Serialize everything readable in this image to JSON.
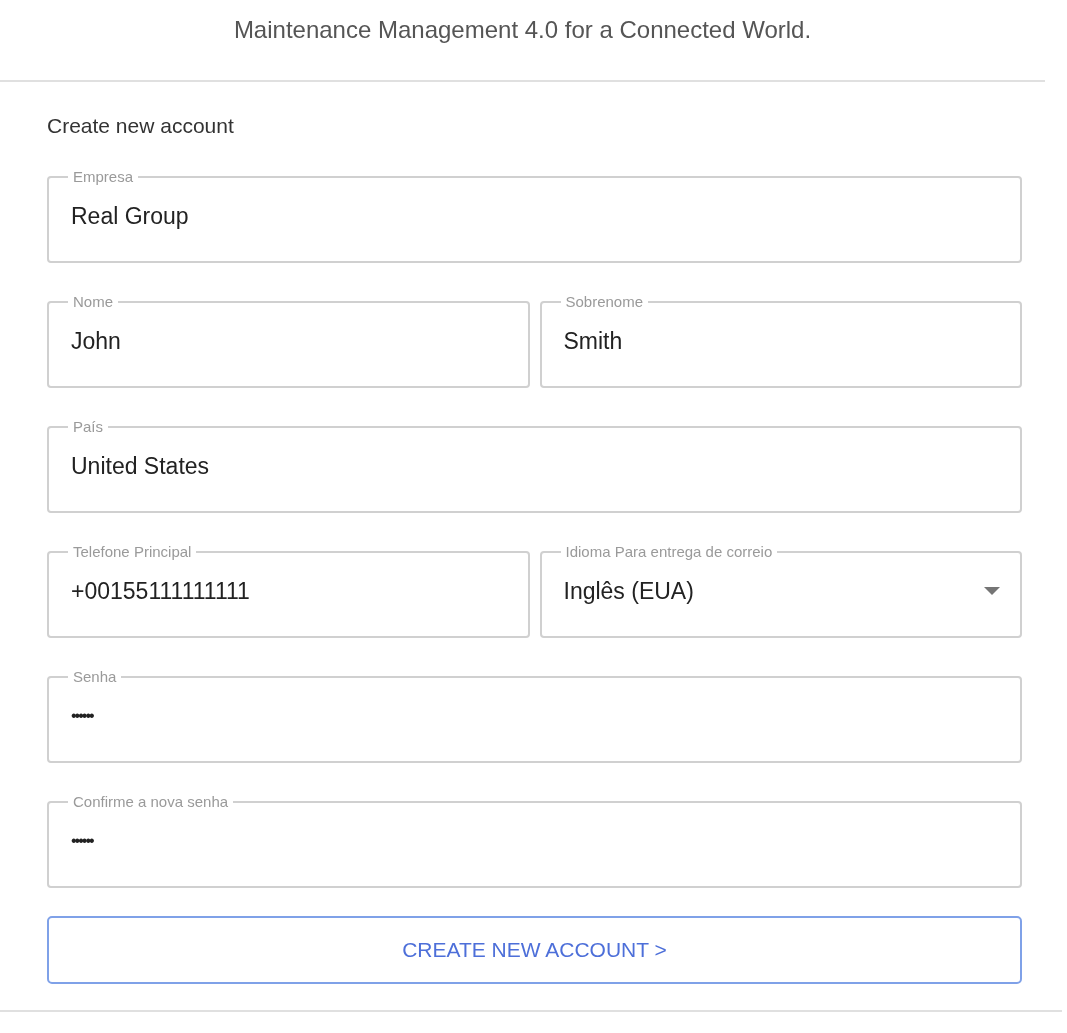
{
  "tagline": "Maintenance Management 4.0 for a Connected World.",
  "form": {
    "heading": "Create new account",
    "rows": [
      [
        {
          "kind": "text",
          "label": "Empresa",
          "value": "Real Group"
        }
      ],
      [
        {
          "kind": "text",
          "label": "Nome",
          "value": "John"
        },
        {
          "kind": "text",
          "label": "Sobrenome",
          "value": "Smith"
        }
      ],
      [
        {
          "kind": "text",
          "label": "País",
          "value": "United States"
        }
      ],
      [
        {
          "kind": "text",
          "label": "Telefone Principal",
          "value": "+00155111111111"
        },
        {
          "kind": "select",
          "label": "Idioma Para entrega de correio",
          "value": "Inglês (EUA)"
        }
      ],
      [
        {
          "kind": "password",
          "label": "Senha",
          "value": "••••••"
        }
      ],
      [
        {
          "kind": "password",
          "label": "Confirme a nova senha",
          "value": "••••••"
        }
      ]
    ],
    "submit": "CREATE NEW ACCOUNT >"
  }
}
